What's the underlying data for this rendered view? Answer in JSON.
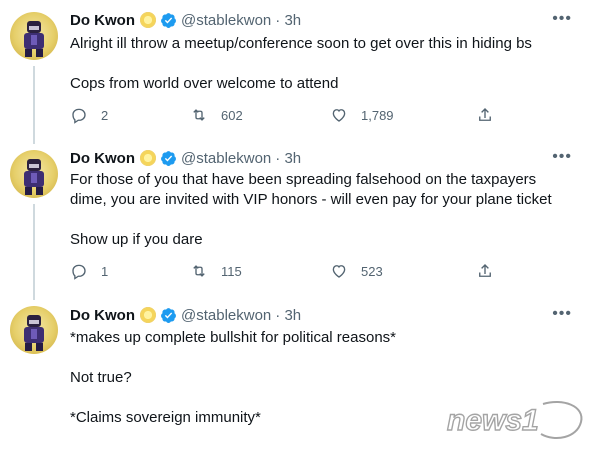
{
  "tweets": [
    {
      "name": "Do Kwon",
      "handle": "@stablekwon",
      "time": "· 3h",
      "lines": [
        "Alright ill throw a meetup/conference soon to get over this in hiding bs",
        "",
        "Cops from world over welcome to attend"
      ],
      "replies": "2",
      "retweets": "602",
      "likes": "1,789"
    },
    {
      "name": "Do Kwon",
      "handle": "@stablekwon",
      "time": "· 3h",
      "lines": [
        "For those of you that have been spreading falsehood on the taxpayers",
        "dime, you are invited with VIP honors - will even pay for your plane ticket",
        "",
        "Show up if you dare"
      ],
      "replies": "1",
      "retweets": "115",
      "likes": "523"
    },
    {
      "name": "Do Kwon",
      "handle": "@stablekwon",
      "time": "· 3h",
      "lines": [
        "*makes up complete bullshit for political reasons*",
        "",
        "Not true?",
        "",
        "*Claims sovereign immunity*"
      ]
    }
  ],
  "watermark": "news1",
  "icons": {
    "more": "more-dots-icon",
    "verified": "verified-badge-icon",
    "reply": "reply-icon",
    "retweet": "retweet-icon",
    "like": "heart-icon",
    "share": "share-icon"
  },
  "colors": {
    "text": "#0f1419",
    "secondary": "#536471",
    "verified": "#1d9bf0",
    "thread_line": "#cfd9de"
  }
}
